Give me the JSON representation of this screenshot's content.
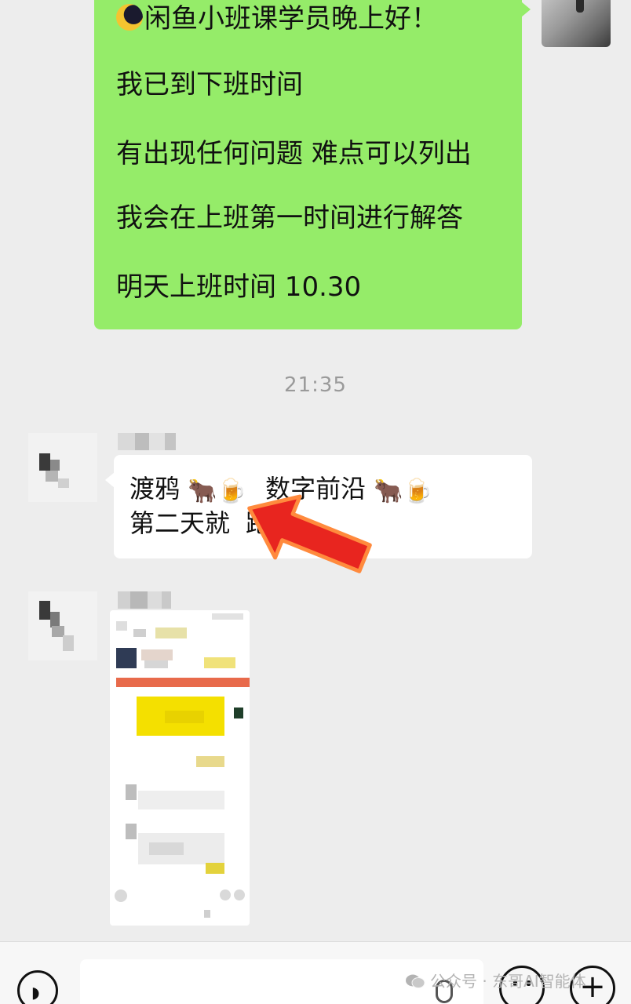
{
  "outgoing_message": {
    "lines": [
      "闲鱼小班课学员晚上好！",
      "我已到下班时间",
      "有出现任何问题 难点可以列出",
      "我会在上班第一时间进行解答",
      "明天上班时间 10.30"
    ],
    "bubble_color": "#95ec69"
  },
  "timestamp": "21:35",
  "incoming_text_message": {
    "line1_part1": "渡鸦",
    "line1_part2": "数字前沿",
    "line2": "第二天就",
    "line2_tail": "跑了",
    "emoji_ox": "🐂",
    "emoji_beer": "🍺",
    "arrow_color": "#e8251f"
  },
  "watermark": {
    "text": "公众号 · 东哥AI智能体"
  },
  "colors": {
    "chat_background": "#ededed",
    "bubble_incoming": "#ffffff",
    "timestamp_text": "#9a9a9a"
  }
}
